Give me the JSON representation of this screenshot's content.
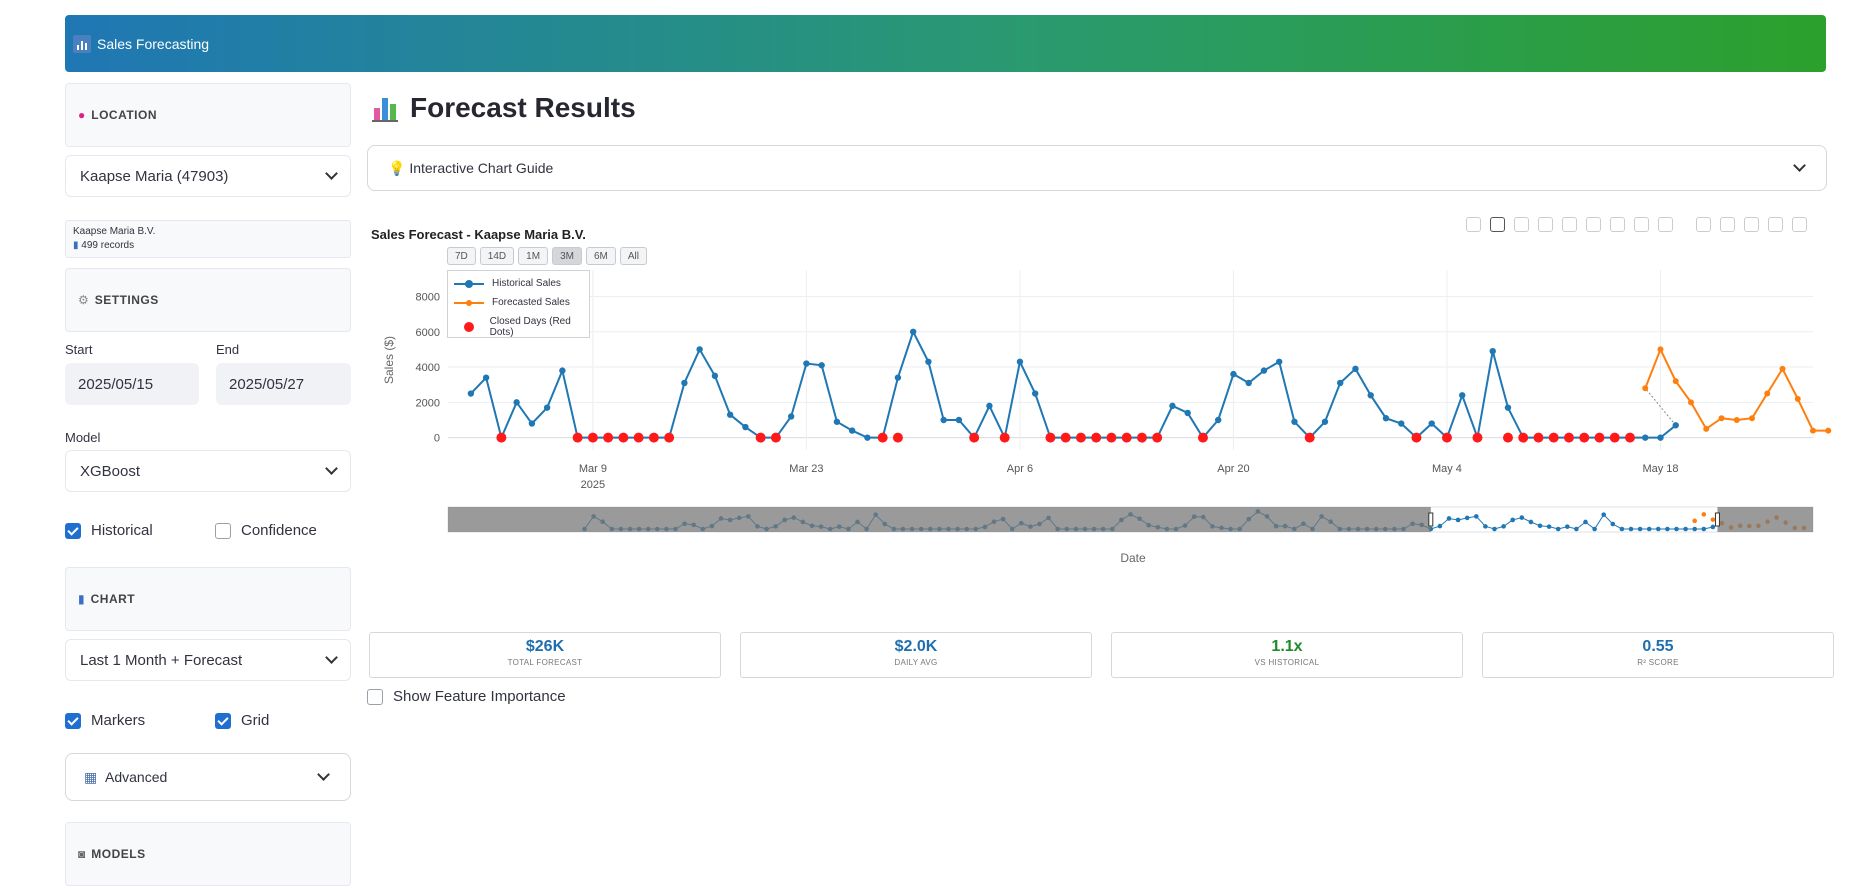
{
  "app": {
    "title": "Sales Forecasting"
  },
  "sidebar": {
    "location_section": "LOCATION",
    "location_value": "Kaapse Maria (47903)",
    "info_name": "Kaapse Maria B.V.",
    "info_records": "499 records",
    "settings_section": "SETTINGS",
    "start_label": "Start",
    "start_value": "2025/05/15",
    "end_label": "End",
    "end_value": "2025/05/27",
    "model_label": "Model",
    "model_value": "XGBoost",
    "historical_label": "Historical",
    "historical_checked": true,
    "confidence_label": "Confidence",
    "confidence_checked": false,
    "chart_section": "CHART",
    "chart_range_value": "Last 1 Month + Forecast",
    "markers_label": "Markers",
    "markers_checked": true,
    "grid_label": "Grid",
    "grid_checked": true,
    "advanced_label": "Advanced",
    "models_section": "MODELS"
  },
  "main": {
    "title": "Forecast Results",
    "guide_label": "Interactive Chart Guide",
    "range_buttons": [
      "7D",
      "14D",
      "1M",
      "3M",
      "6M",
      "All"
    ],
    "range_active": "3M",
    "show_feature_importance": "Show Feature Importance"
  },
  "metrics": [
    {
      "value": "$26K",
      "label": "TOTAL FORECAST",
      "color": "#1f6fb0"
    },
    {
      "value": "$2.0K",
      "label": "DAILY AVG",
      "color": "#1f6fb0"
    },
    {
      "value": "1.1x",
      "label": "VS HISTORICAL",
      "color": "#1e8a2a"
    },
    {
      "value": "0.55",
      "label": "R² SCORE",
      "color": "#1f6fb0"
    }
  ],
  "colors": {
    "historical": "#1f77b4",
    "forecast": "#ff7f0e",
    "closed": "#ff1a1a"
  },
  "chart_data": {
    "type": "line",
    "title": "Sales Forecast - Kaapse Maria B.V.",
    "xlabel": "Date",
    "ylabel": "Sales ($)",
    "ylim": [
      -700,
      9500
    ],
    "yticks": [
      0,
      2000,
      4000,
      6000,
      8000
    ],
    "xticks": [
      "Mar 9",
      "Mar 23",
      "Apr 6",
      "Apr 20",
      "May 4",
      "May 18"
    ],
    "xtick_sub": "2025",
    "grid": true,
    "legend_placement": "top-left",
    "series": [
      {
        "name": "Historical Sales",
        "start_day": 0,
        "values": [
          2500,
          3400,
          0,
          2000,
          800,
          1700,
          3800,
          0,
          0,
          0,
          0,
          0,
          0,
          0,
          3100,
          5000,
          3500,
          1300,
          600,
          0,
          0,
          1200,
          4200,
          4100,
          900,
          400,
          0,
          0,
          3400,
          6000,
          4300,
          1000,
          1000,
          0,
          1800,
          0,
          4300,
          2500,
          0,
          0,
          0,
          0,
          0,
          0,
          0,
          0,
          1800,
          1400,
          0,
          1000,
          3600,
          3100,
          3800,
          4300,
          900,
          0,
          900,
          3100,
          3900,
          2400,
          1100,
          800,
          0,
          800,
          0,
          2400,
          0,
          4900,
          1700,
          0,
          0,
          0,
          0,
          0,
          0,
          0,
          0,
          0,
          0,
          700
        ]
      },
      {
        "name": "Forecasted Sales",
        "start_day": 77,
        "values": [
          2800,
          5000,
          3200,
          2000,
          500,
          1100,
          1000,
          1100,
          2500,
          3900,
          2200,
          400,
          400
        ]
      },
      {
        "name": "Closed Days (Red Dots)",
        "days": [
          2,
          7,
          8,
          9,
          10,
          11,
          12,
          13,
          19,
          20,
          27,
          28,
          33,
          35,
          38,
          39,
          40,
          41,
          42,
          43,
          44,
          45,
          48,
          55,
          62,
          64,
          66,
          68,
          69,
          70,
          71,
          72,
          73,
          74,
          75,
          76
        ]
      }
    ]
  }
}
